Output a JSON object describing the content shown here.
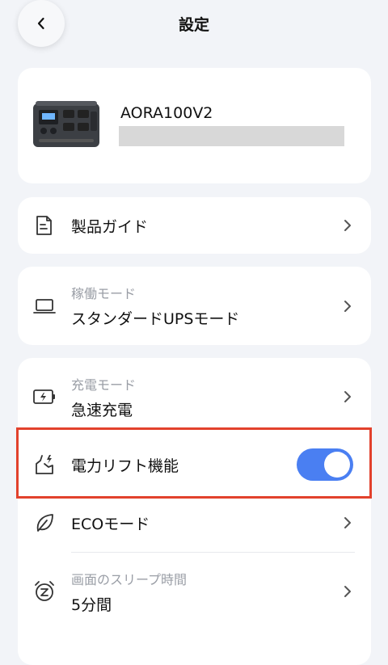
{
  "header": {
    "title": "設定"
  },
  "device": {
    "name": "AORA100V2"
  },
  "product_guide": {
    "label": "製品ガイド"
  },
  "operation_mode": {
    "caption": "稼働モード",
    "value": "スタンダードUPSモード"
  },
  "charge_mode": {
    "caption": "充電モード",
    "value": "急速充電"
  },
  "power_lift": {
    "label": "電力リフト機能",
    "enabled": true
  },
  "eco_mode": {
    "label": "ECOモード"
  },
  "screen_sleep": {
    "caption": "画面のスリープ時間",
    "value": "5分間"
  },
  "colors": {
    "accent": "#4a7ff2",
    "highlight_border": "#e2412c",
    "background": "#f2f4f8"
  },
  "icons": {
    "back": "chevron-left-icon",
    "product_guide": "document-icon",
    "operation_mode": "laptop-icon",
    "charge_mode": "battery-charging-icon",
    "power_lift": "power-lift-icon",
    "eco_mode": "leaf-icon",
    "screen_sleep": "alarm-clock-z-icon",
    "row_arrow": "chevron-right-icon"
  }
}
